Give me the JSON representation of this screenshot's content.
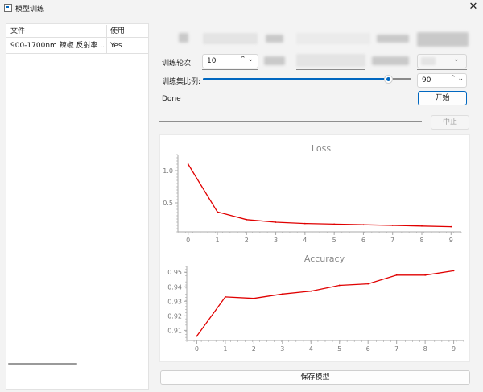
{
  "window": {
    "title": "模型训练",
    "close_glyph": "✕"
  },
  "file_table": {
    "columns": [
      "文件",
      "使用"
    ],
    "rows": [
      {
        "file": "900-1700nm 辣椒 反射率 ...",
        "use": "Yes"
      }
    ]
  },
  "form": {
    "epochs": {
      "label": "训练轮次:",
      "value": "10",
      "arrows": "⌃⌄"
    },
    "ratio": {
      "label": "训练集比例:",
      "value": "90",
      "slider_fraction": 0.9,
      "arrows": "⌃⌄"
    },
    "task_type_label": "任务类型:",
    "extra_arrows": "⌄"
  },
  "status": "Done",
  "buttons": {
    "start": "开始",
    "stop": "中止",
    "save": "保存模型"
  },
  "colors": {
    "accent": "#0067c0",
    "series": "#e00000"
  },
  "chart_data": [
    {
      "type": "line",
      "title": "Loss",
      "x": [
        0,
        1,
        2,
        3,
        4,
        5,
        6,
        7,
        8,
        9
      ],
      "y": [
        1.1,
        0.36,
        0.24,
        0.2,
        0.18,
        0.17,
        0.16,
        0.15,
        0.14,
        0.13
      ],
      "xlim": [
        -0.35,
        9.35
      ],
      "ylim": [
        0.05,
        1.25
      ],
      "yticks": [
        0.5,
        1.0
      ],
      "ytick_labels": [
        "0.5",
        "1.0"
      ],
      "xtick_labels": [
        "0",
        "1",
        "2",
        "3",
        "4",
        "5",
        "6",
        "7",
        "8",
        "9"
      ],
      "grid": false
    },
    {
      "type": "line",
      "title": "Accuracy",
      "x": [
        0,
        1,
        2,
        3,
        4,
        5,
        6,
        7,
        8,
        9
      ],
      "y": [
        0.906,
        0.933,
        0.932,
        0.935,
        0.937,
        0.941,
        0.942,
        0.948,
        0.948,
        0.951
      ],
      "xlim": [
        -0.35,
        9.35
      ],
      "ylim": [
        0.903,
        0.954
      ],
      "yticks": [
        0.91,
        0.92,
        0.93,
        0.94,
        0.95
      ],
      "ytick_labels": [
        "0.91",
        "0.92",
        "0.93",
        "0.94",
        "0.95"
      ],
      "xtick_labels": [
        "0",
        "1",
        "2",
        "3",
        "4",
        "5",
        "6",
        "7",
        "8",
        "9"
      ],
      "grid": false
    }
  ]
}
